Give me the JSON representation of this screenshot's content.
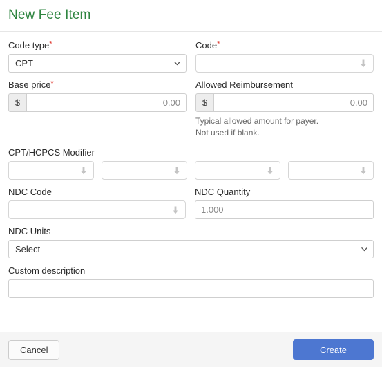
{
  "modal": {
    "title": "New Fee Item"
  },
  "fields": {
    "code_type": {
      "label": "Code type",
      "required_marker": "*",
      "value": "CPT",
      "options": [
        "CPT"
      ]
    },
    "code": {
      "label": "Code",
      "required_marker": "*",
      "value": "",
      "placeholder": ""
    },
    "base_price": {
      "label": "Base price",
      "required_marker": "*",
      "currency_symbol": "$",
      "value": "",
      "placeholder": "0.00"
    },
    "allowed_reimbursement": {
      "label": "Allowed Reimbursement",
      "currency_symbol": "$",
      "value": "",
      "placeholder": "0.00",
      "help_line_1": "Typical allowed amount for payer.",
      "help_line_2": "Not used if blank."
    },
    "modifiers": {
      "label": "CPT/HCPCS Modifier",
      "items": [
        {
          "value": "",
          "placeholder": ""
        },
        {
          "value": "",
          "placeholder": ""
        },
        {
          "value": "",
          "placeholder": ""
        },
        {
          "value": "",
          "placeholder": ""
        }
      ]
    },
    "ndc_code": {
      "label": "NDC Code",
      "value": "",
      "placeholder": ""
    },
    "ndc_quantity": {
      "label": "NDC Quantity",
      "value": "",
      "placeholder": "1.000"
    },
    "ndc_units": {
      "label": "NDC Units",
      "value": "Select",
      "options": [
        "Select"
      ]
    },
    "custom_description": {
      "label": "Custom description",
      "value": "",
      "placeholder": ""
    }
  },
  "footer": {
    "cancel_label": "Cancel",
    "create_label": "Create"
  },
  "colors": {
    "title_green": "#2e8540",
    "primary_blue": "#4d77d1",
    "required_red": "#e03b32",
    "footer_bg": "#f5f5f5"
  }
}
